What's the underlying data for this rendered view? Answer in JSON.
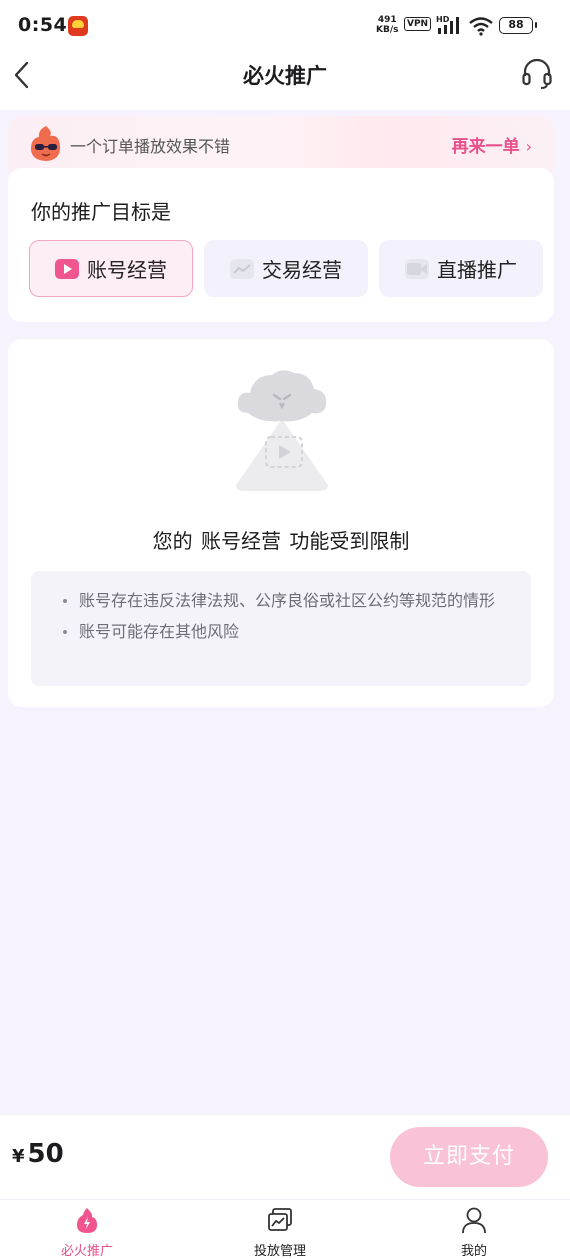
{
  "status_bar": {
    "time": "0:54",
    "net_speed_value": "491",
    "net_speed_unit": "KB/s",
    "vpn": "VPN",
    "network": "HD",
    "battery": "88"
  },
  "header": {
    "title": "必火推广"
  },
  "promo": {
    "text": "一个订单播放效果不错",
    "link_label": "再来一单",
    "link_chevron": "›"
  },
  "goal": {
    "heading": "你的推广目标是",
    "tabs": [
      {
        "label": "账号经营",
        "icon": "video-play-icon",
        "active": true
      },
      {
        "label": "交易经营",
        "icon": "trend-chart-icon",
        "active": false
      },
      {
        "label": "直播推广",
        "icon": "camera-icon",
        "active": false
      }
    ]
  },
  "restriction": {
    "title": "您的 账号经营 功能受到限制",
    "reasons": [
      "账号存在违反法律法规、公序良俗或社区公约等规范的情形",
      "账号可能存在其他风险"
    ]
  },
  "pay_bar": {
    "currency": "¥",
    "amount": "50",
    "pay_label": "立即支付"
  },
  "bottom_nav": {
    "items": [
      {
        "label": "必火推广",
        "icon": "flame-icon",
        "active": true
      },
      {
        "label": "投放管理",
        "icon": "chart-panel-icon",
        "active": false
      },
      {
        "label": "我的",
        "icon": "person-icon",
        "active": false
      }
    ]
  },
  "colors": {
    "accent": "#e8508b",
    "pay_button_disabled": "#f9c2d6",
    "page_background": "#f6f3fe"
  }
}
